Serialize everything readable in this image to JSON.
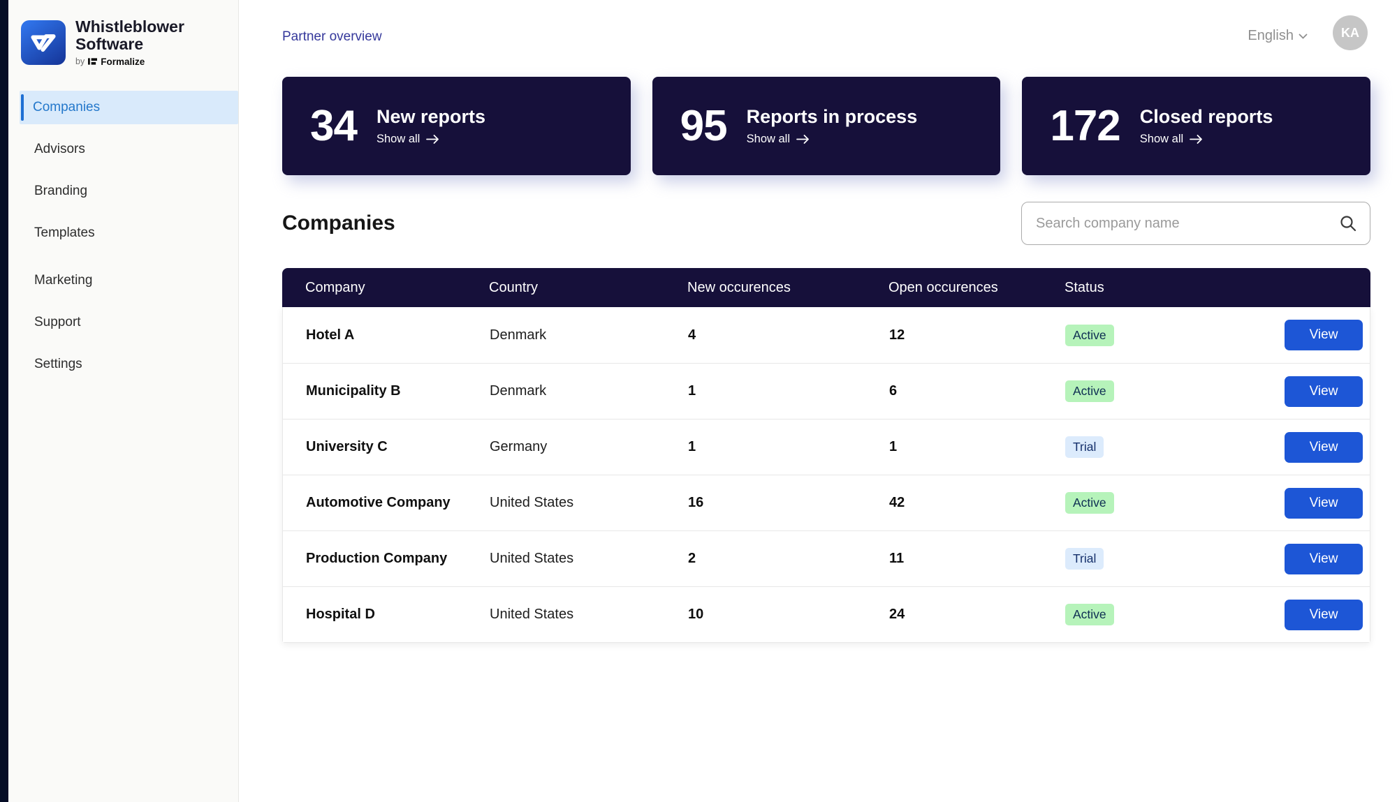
{
  "brand": {
    "name_line1": "Whistleblower",
    "name_line2": "Software",
    "byline_prefix": "by",
    "byline_brand": "Formalize"
  },
  "sidebar": {
    "items": [
      {
        "label": "Companies",
        "active": true
      },
      {
        "label": "Advisors",
        "active": false
      },
      {
        "label": "Branding",
        "active": false
      },
      {
        "label": "Templates",
        "active": false
      },
      {
        "label": "Marketing",
        "active": false
      },
      {
        "label": "Support",
        "active": false
      },
      {
        "label": "Settings",
        "active": false
      }
    ]
  },
  "header": {
    "breadcrumb": "Partner overview",
    "language": "English",
    "avatar_initials": "KA"
  },
  "stats": [
    {
      "value": "34",
      "label": "New reports",
      "link": "Show all"
    },
    {
      "value": "95",
      "label": "Reports in process",
      "link": "Show all"
    },
    {
      "value": "172",
      "label": "Closed reports",
      "link": "Show all"
    }
  ],
  "companies_section": {
    "title": "Companies",
    "search_placeholder": "Search company name",
    "search_value": ""
  },
  "table": {
    "columns": {
      "company": "Company",
      "country": "Country",
      "new_occurrences": "New occurences",
      "open_occurrences": "Open occurences",
      "status": "Status"
    },
    "view_label": "View",
    "rows": [
      {
        "company": "Hotel A",
        "country": "Denmark",
        "new": "4",
        "open": "12",
        "status": "Active"
      },
      {
        "company": "Municipality B",
        "country": "Denmark",
        "new": "1",
        "open": "6",
        "status": "Active"
      },
      {
        "company": "University C",
        "country": "Germany",
        "new": "1",
        "open": "1",
        "status": "Trial"
      },
      {
        "company": "Automotive Company",
        "country": "United States",
        "new": "16",
        "open": "42",
        "status": "Active"
      },
      {
        "company": "Production Company",
        "country": "United States",
        "new": "2",
        "open": "11",
        "status": "Trial"
      },
      {
        "company": "Hospital D",
        "country": "United States",
        "new": "10",
        "open": "24",
        "status": "Active"
      }
    ]
  },
  "icons": {
    "logo": "whistleblower-w-mark",
    "formalize": "formalize-flag-icon",
    "language_chevron": "chevron-down",
    "show_all_arrow": "arrow-right",
    "search": "magnifier"
  },
  "colors": {
    "dark_navy": "#16103a",
    "primary_blue": "#1d56d6",
    "active_badge_bg": "#b6f3ba",
    "trial_badge_bg": "#dcebfc",
    "sidebar_active_bg": "#d9eafb",
    "sidebar_active_text": "#2478cb",
    "breadcrumb_text": "#35389b",
    "edge_strip": "#050d26"
  }
}
